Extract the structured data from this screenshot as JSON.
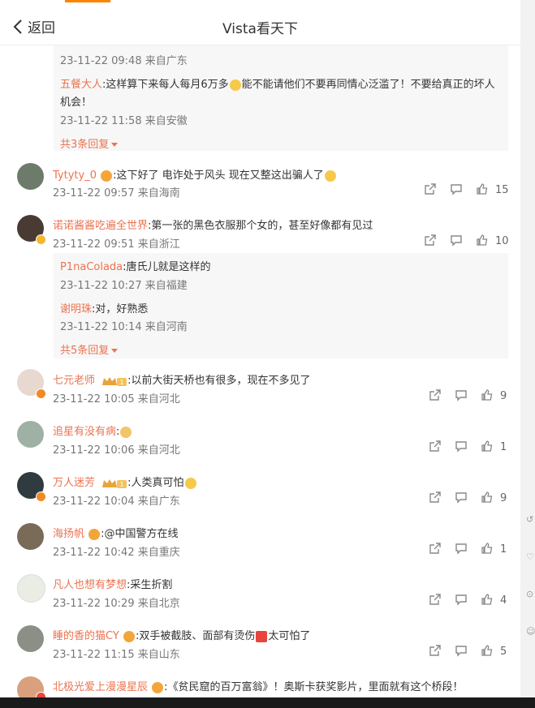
{
  "header": {
    "back_label": "返回",
    "title": "Vista看天下"
  },
  "sub_top": {
    "meta1": "23-11-22 09:48 来自广东",
    "reply_name": "五餐大人",
    "reply_text_a": ":这样算下来每人每月6万多",
    "reply_text_b": "能不能请他们不要再同情心泛滥了！不要给真正的坏人",
    "reply_text_c": "机会！",
    "meta2": "23-11-22 11:58 来自安徽",
    "more": "共3条回复"
  },
  "comments": [
    {
      "name": "Tytyty_0",
      "text": ":这下好了  电诈处于风头  现在又整这出骗人了",
      "meta": "23-11-22 09:57 来自海南",
      "likes": "15",
      "avatar_color": "#6d7b6a"
    },
    {
      "name": "诺诺酱酱吃遍全世界",
      "text": ":第一张的黑色衣服那个女的，甚至好像都有见过",
      "meta": "23-11-22 09:51 来自浙江",
      "likes": "10",
      "avatar_color": "#4a3a34"
    },
    {
      "name": "七元老师",
      "text": ":以前大街天桥也有很多，现在不多见了",
      "meta": "23-11-22 10:05 来自河北",
      "likes": "9",
      "avatar_color": "#e7d9cf"
    },
    {
      "name": "追星有没有病",
      "text": ":",
      "meta": "23-11-22 10:06 来自河北",
      "likes": "1",
      "avatar_color": "#9fb0a4"
    },
    {
      "name": "万人迷芳",
      "text": ":人类真可怕",
      "meta": "23-11-22 10:04 来自广东",
      "likes": "9",
      "avatar_color": "#2f3b3e"
    },
    {
      "name": "海扬帆",
      "text": ":@中国警方在线",
      "meta": "23-11-22 10:42 来自重庆",
      "likes": "1",
      "avatar_color": "#7a6a58"
    },
    {
      "name": "凡人也想有梦想",
      "text": ":采生折割",
      "meta": "23-11-22 10:29 来自北京",
      "likes": "4",
      "avatar_color": "#e9ede4"
    },
    {
      "name": "睡的香的猫CY",
      "text": ":双手被截肢、面部有烫伤",
      "text_b": "太可怕了",
      "meta": "23-11-22 11:15 来自山东",
      "likes": "5",
      "avatar_color": "#8c8f86"
    },
    {
      "name": "北极光爱上漫漫星辰",
      "text": ":《贫民窟的百万富翁》！奥斯卡获奖影片，里面就有这个桥段！",
      "avatar_color": "#d9a07d"
    }
  ],
  "replies_2": [
    {
      "name": "P1naColada",
      "text": ":唐氏儿就是这样的",
      "meta": "23-11-22 10:27 来自福建"
    },
    {
      "name": "谢明珠",
      "text": ":对，好熟悉",
      "meta": "23-11-22 10:14 来自河南"
    }
  ],
  "more_2": "共5条回复",
  "badges": {
    "level1": "1"
  },
  "colors": {
    "accent": "#ff8200",
    "name": "#eb7350",
    "vip": "#e8a33d"
  }
}
